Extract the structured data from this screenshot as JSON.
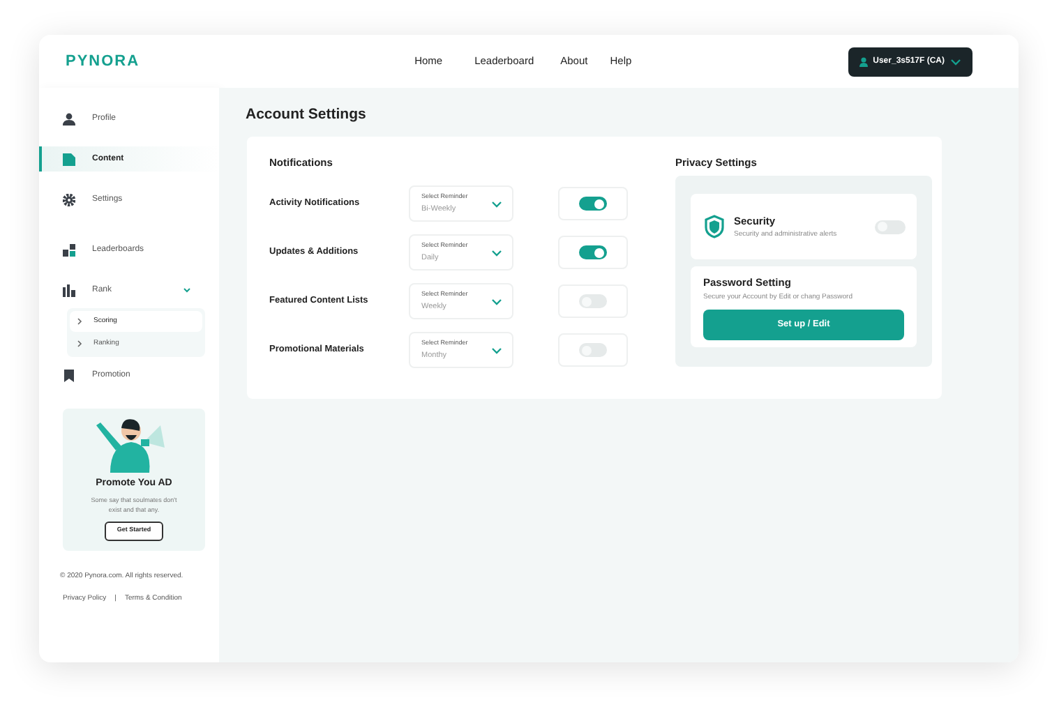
{
  "brand": {
    "logo": "PYNORA"
  },
  "nav": [
    {
      "label": "Home"
    },
    {
      "label": "Leaderboard"
    },
    {
      "label": "About"
    },
    {
      "label": "Help"
    }
  ],
  "user_menu": {
    "label": "User_3s517F (CA)"
  },
  "sidebar": {
    "items": [
      {
        "label": "Profile",
        "selected": false
      },
      {
        "label": "Content",
        "selected": true
      },
      {
        "label": "Settings",
        "selected": false
      },
      {
        "label": "Leaderboards",
        "selected": false
      },
      {
        "label": "Rank",
        "selected": false,
        "expanded": true,
        "children": [
          {
            "label": "Scoring",
            "selected": true
          },
          {
            "label": "Ranking",
            "selected": false
          }
        ]
      },
      {
        "label": "Promotion",
        "selected": false
      }
    ]
  },
  "promo": {
    "title": "Promote You AD",
    "text": "Some say that soulmates don't exist and that any.",
    "button": "Get Started"
  },
  "footer": {
    "copyright": "© 2020 Pynora.com. All rights reserved.",
    "links": [
      "Privacy Policy",
      "Terms & Condition"
    ],
    "separator": "|"
  },
  "page_title": "Account Settings",
  "notifications": {
    "title": "Notifications",
    "rows": [
      {
        "label": "Activity Notifications",
        "select_label": "Select Reminder",
        "value": "Bi-Weekly",
        "on": true
      },
      {
        "label": "Updates & Additions",
        "select_label": "Select Reminder",
        "value": "Daily",
        "on": true
      },
      {
        "label": "Featured Content Lists",
        "select_label": "Select Reminder",
        "value": "Weekly",
        "on": false
      },
      {
        "label": "Promotional Materials",
        "select_label": "Select Reminder",
        "value": "Monthy",
        "on": false
      }
    ]
  },
  "privacy": {
    "title": "Privacy Settings",
    "security": {
      "title": "Security",
      "text": "Security and administrative alerts",
      "on": false
    },
    "password": {
      "title": "Password Setting",
      "text": "Secure your Account by Edit or chang Password",
      "button": "Set up / Edit"
    }
  }
}
